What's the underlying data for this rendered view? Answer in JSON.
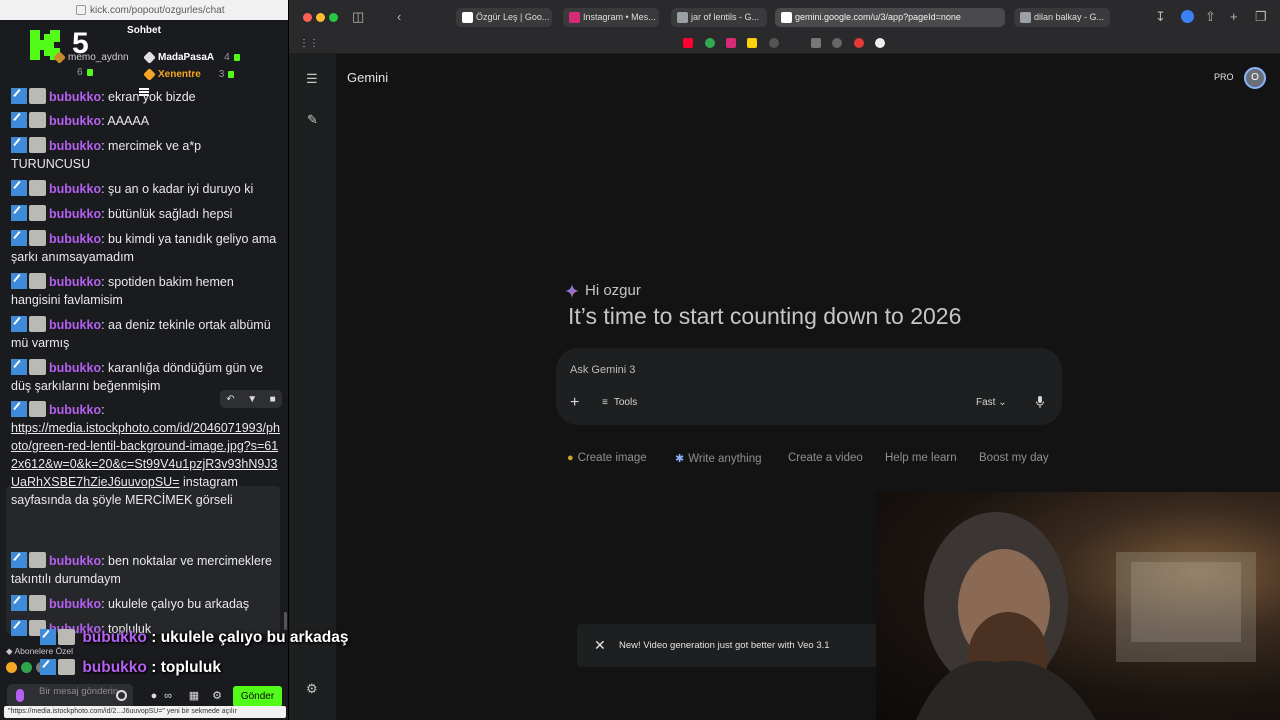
{
  "chat": {
    "url": "kick.com/popout/ozgurles/chat",
    "header": "Sohbet",
    "streak_number": "5",
    "leaderboard": [
      {
        "name": "memo_aydnn",
        "count": "6"
      },
      {
        "name": "MadaPasaA",
        "count": "4"
      },
      {
        "name": "Xenentre",
        "count": "3"
      }
    ],
    "messages": [
      {
        "user": "bubukko",
        "text": "ekran yok bizde"
      },
      {
        "user": "bubukko",
        "text": "AAAAA"
      },
      {
        "user": "bubukko",
        "text": "mercimek ve a*p TURUNCUSU"
      },
      {
        "user": "bubukko",
        "text": "şu an o kadar iyi duruyo ki"
      },
      {
        "user": "bubukko",
        "text": "bütünlük sağladı hepsi"
      },
      {
        "user": "bubukko",
        "text": "bu kimdi ya tanıdık geliyo ama şarkı anımsayamadım"
      },
      {
        "user": "bubukko",
        "text": "spotiden bakim hemen hangisini favlamisim"
      },
      {
        "user": "bubukko",
        "text": "aa deniz tekinle ortak albümü mü varmış"
      },
      {
        "user": "bubukko",
        "text": "karanlığa döndüğüm gün ve düş şarkılarını beğenmişim"
      },
      {
        "user": "bubukko",
        "link": "https://media.istockphoto.com/id/2046071993/photo/green-red-lentil-background-image.jpg?s=612x612&w=0&k=20&c=St99V4u1pzjR3v93hN9J3UaRhXSBE7hZieJ6uuvopSU=",
        "text": "instagram sayfasında da şöyle MERCİMEK görseli"
      },
      {
        "user": "bubukko",
        "text": "ben noktalar ve mercimeklere takıntılı durumdaym"
      },
      {
        "user": "bubukko",
        "text": "ukulele çalıyo bu arkadaş"
      },
      {
        "user": "bubukko",
        "text": "topluluk"
      }
    ],
    "sub_only_label": "Abonelere Özel",
    "input_placeholder": "Bir mesaj gönderin",
    "send_label": "Gönder",
    "status_url": "\"https://media.istockphoto.com/id/2...J6uuvopSU=\" yeni bir sekmede açılır"
  },
  "overlay": [
    {
      "user": "bubukko",
      "text": "ukulele çalıyo bu arkadaş"
    },
    {
      "user": "bubukko",
      "text": "topluluk"
    }
  ],
  "browser": {
    "tabs": [
      {
        "label": "Özgür Leş | Goo...",
        "active": false
      },
      {
        "label": "Instagram • Mes...",
        "active": false
      },
      {
        "label": "jar of lentils - G...",
        "active": false
      },
      {
        "label": "gemini.google.com/u/3/app?pageId=none",
        "active": true
      },
      {
        "label": "dilan balkay - G...",
        "active": false
      }
    ]
  },
  "gemini": {
    "title": "Gemini",
    "pro_label": "PRO",
    "avatar_initial": "O",
    "greeting_hi": "Hi ozgur",
    "greeting_main": "It’s time to start counting down to 2026",
    "prompt_placeholder": "Ask Gemini 3",
    "tools_label": "Tools",
    "mode_label": "Fast",
    "chips": [
      "Create image",
      "Write anything",
      "Create a video",
      "Help me learn",
      "Boost my day"
    ],
    "toast": "New! Video generation just got better with Veo 3.1"
  },
  "colors": {
    "kick_green": "#53fc18",
    "username_purple": "#b460f0",
    "gemini_bg": "#131314"
  }
}
